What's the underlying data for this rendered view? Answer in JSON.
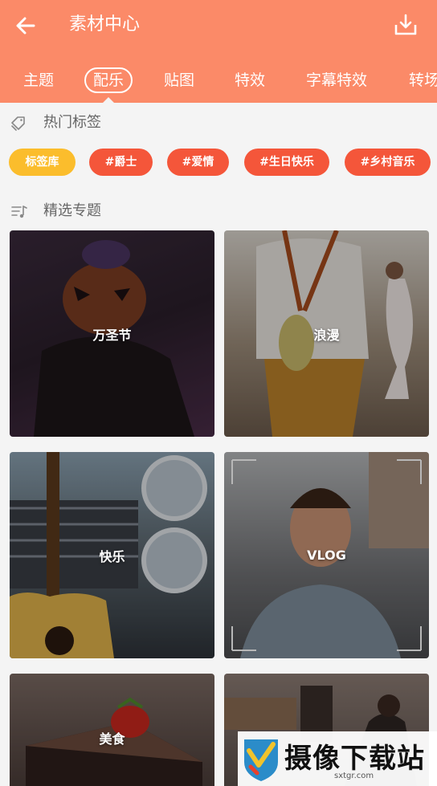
{
  "header": {
    "title": "素材中心",
    "background": "#fb8a68"
  },
  "tabs": [
    {
      "label": "主题"
    },
    {
      "label": "配乐",
      "active": true
    },
    {
      "label": "贴图"
    },
    {
      "label": "特效"
    },
    {
      "label": "字幕特效"
    },
    {
      "label": "转场"
    }
  ],
  "hot_tags": {
    "title": "热门标签",
    "library_label": "标签库",
    "tags": [
      "#爵士",
      "#爱情",
      "#生日快乐",
      "#乡村音乐"
    ]
  },
  "featured": {
    "title": "精选专题",
    "cards": [
      {
        "label": "万圣节"
      },
      {
        "label": "浪漫"
      },
      {
        "label": "快乐"
      },
      {
        "label": "VLOG"
      },
      {
        "label": "美食"
      },
      {
        "label": ""
      }
    ]
  },
  "watermark": {
    "text": "摄像下载站",
    "url": "sxtgr.com"
  }
}
